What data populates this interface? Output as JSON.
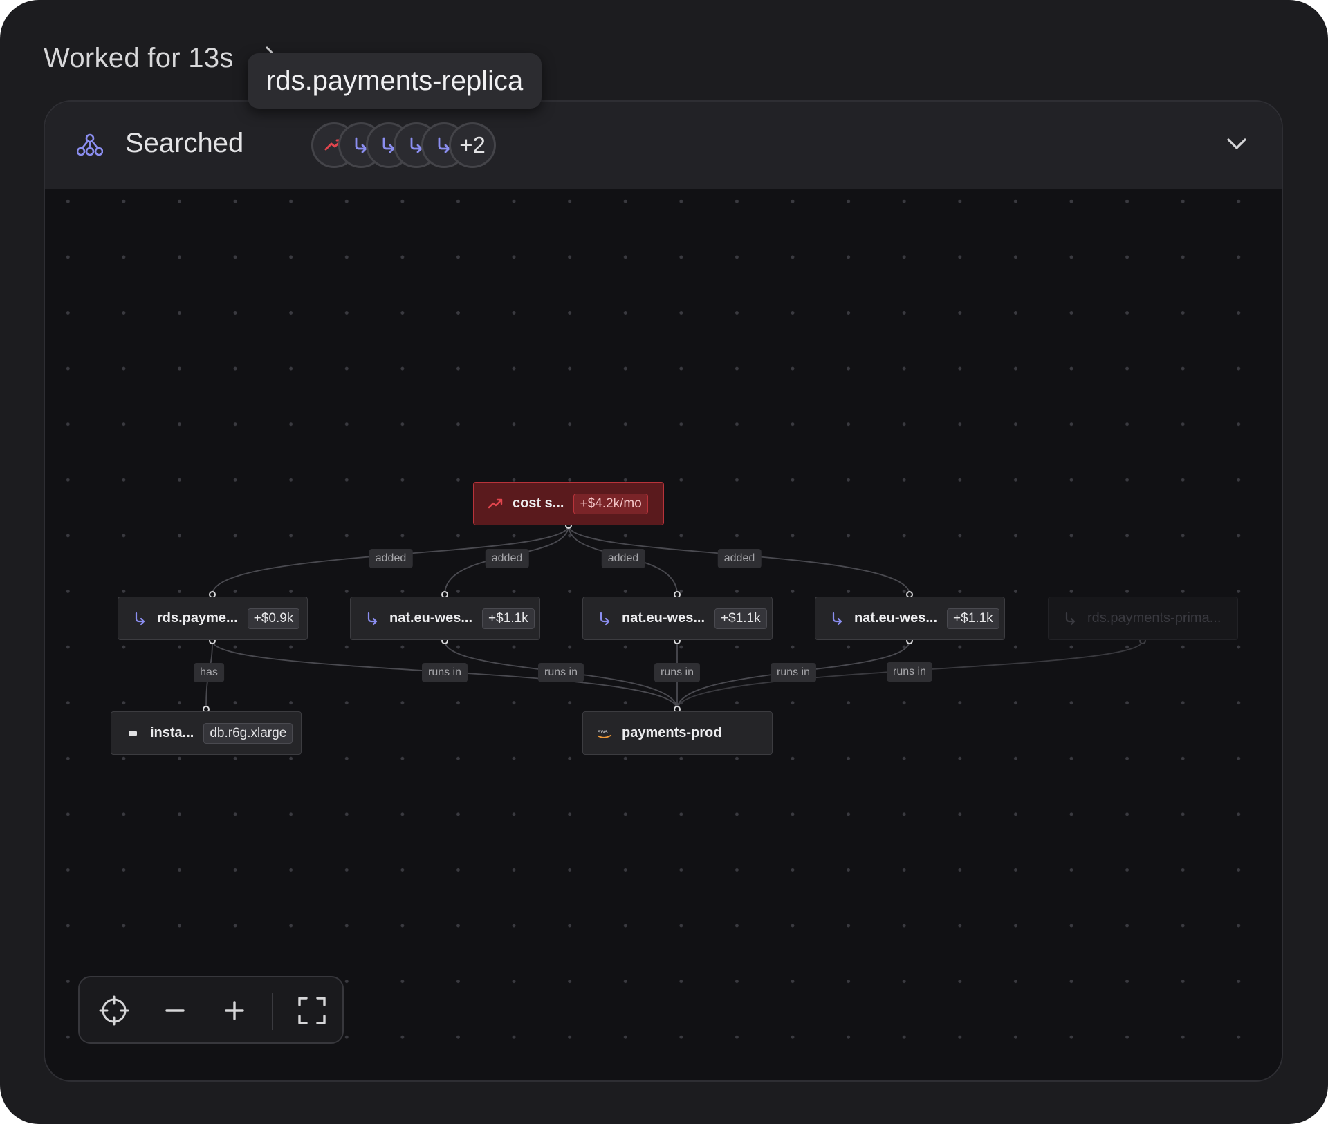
{
  "status": {
    "worked_label": "Worked for 13s"
  },
  "tooltip": {
    "text": "rds.payments-replica"
  },
  "header": {
    "title": "Searched",
    "chips": [
      {
        "icon": "trend-up-icon",
        "color": "#e0454d"
      },
      {
        "icon": "branch-arrow-icon",
        "color": "#8b8ef0"
      },
      {
        "icon": "branch-arrow-icon",
        "color": "#8b8ef0"
      },
      {
        "icon": "branch-arrow-icon",
        "color": "#8b8ef0"
      },
      {
        "icon": "branch-arrow-icon",
        "color": "#8b8ef0"
      }
    ],
    "more_count": "+2"
  },
  "graph": {
    "nodes": {
      "cost": {
        "label": "cost s...",
        "tag": "+$4.2k/mo",
        "icon": "trend-up-icon",
        "variant": "alert"
      },
      "rds_replica": {
        "label": "rds.payme...",
        "tag": "+$0.9k",
        "icon": "branch-arrow-icon"
      },
      "nat1": {
        "label": "nat.eu-wes...",
        "tag": "+$1.1k",
        "icon": "branch-arrow-icon"
      },
      "nat2": {
        "label": "nat.eu-wes...",
        "tag": "+$1.1k",
        "icon": "branch-arrow-icon"
      },
      "nat3": {
        "label": "nat.eu-wes...",
        "tag": "+$1.1k",
        "icon": "branch-arrow-icon"
      },
      "rds_primary": {
        "label": "rds.payments-prima...",
        "icon": "branch-arrow-icon",
        "variant": "faded"
      },
      "instance": {
        "label": "insta...",
        "tag": "db.r6g.xlarge",
        "icon": "server-icon"
      },
      "account": {
        "label": "payments-prod",
        "icon": "aws-logo-icon",
        "icon_text": "aws"
      }
    },
    "edge_labels": {
      "added": "added",
      "has": "has",
      "runs_in": "runs in"
    }
  },
  "colors": {
    "accent_purple": "#8b8ef0",
    "alert_red": "#e0454d",
    "aws_orange": "#f29b38"
  }
}
